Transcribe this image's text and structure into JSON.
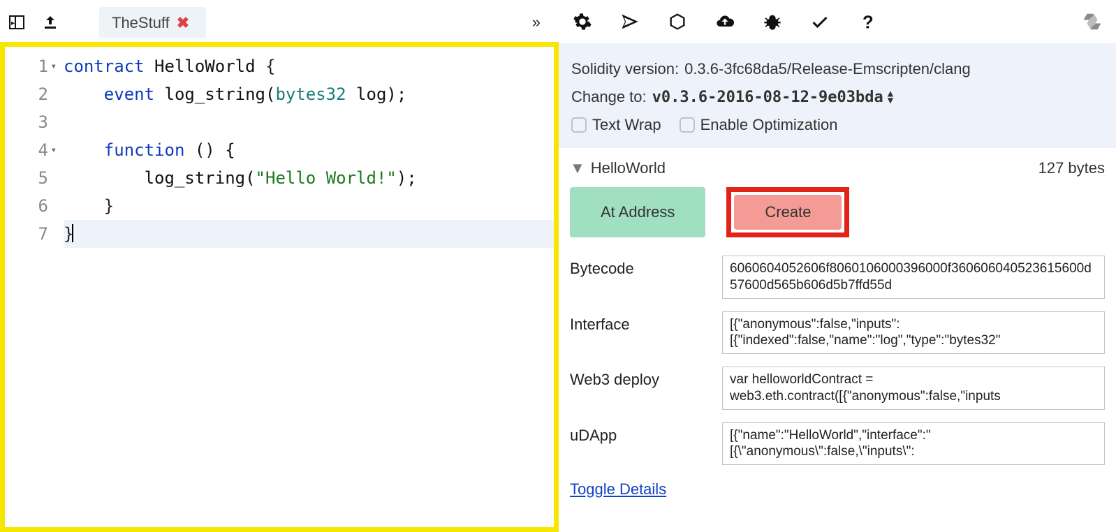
{
  "left": {
    "tab_name": "TheStuff",
    "tab_overflow": "»"
  },
  "editor": {
    "gutter": [
      "1",
      "2",
      "3",
      "4",
      "5",
      "6",
      "7"
    ],
    "code": {
      "l1": {
        "kw": "contract",
        "id": " HelloWorld ",
        "brace": "{"
      },
      "l2": {
        "indent": "    ",
        "kw": "event",
        "id": " log_string(",
        "type": "bytes32",
        "rest": " log);"
      },
      "l3": "",
      "l4": {
        "indent": "    ",
        "kw": "function",
        "rest": " () {"
      },
      "l5": {
        "indent": "        ",
        "call": "log_string(",
        "str": "\"Hello World!\"",
        "close": ");"
      },
      "l6": {
        "indent": "    ",
        "brace": "}"
      },
      "l7": {
        "brace": "}"
      }
    }
  },
  "settings": {
    "version_label": "Solidity version:",
    "version_value": "0.3.6-3fc68da5/Release-Emscripten/clang",
    "change_label": "Change to:",
    "change_value": "v0.3.6-2016-08-12-9e03bda",
    "wrap_label": "Text Wrap",
    "opt_label": "Enable Optimization"
  },
  "contract": {
    "name": "HelloWorld",
    "bytes": "127 bytes",
    "at_address_label": "At Address",
    "create_label": "Create",
    "details": {
      "bytecode_label": "Bytecode",
      "bytecode_value": "6060604052606f8060106000396000f360606040523615600d57600d565b606d5b7ffd55d",
      "interface_label": "Interface",
      "interface_value": "[{\"anonymous\":false,\"inputs\":[{\"indexed\":false,\"name\":\"log\",\"type\":\"bytes32\"",
      "web3_label": "Web3 deploy",
      "web3_value": "var helloworldContract = web3.eth.contract([{\"anonymous\":false,\"inputs",
      "udapp_label": "uDApp",
      "udapp_value": "[{\"name\":\"HelloWorld\",\"interface\":\"[{\\\"anonymous\\\":false,\\\"inputs\\\":"
    },
    "toggle_label": "Toggle Details"
  }
}
